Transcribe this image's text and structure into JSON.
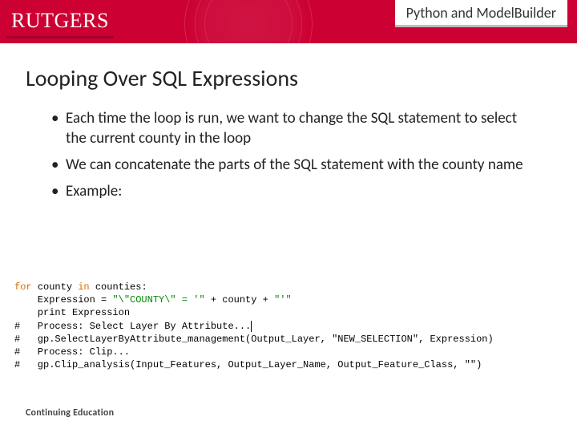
{
  "header": {
    "logo_text": "RUTGERS",
    "right_label": "Python and ModelBuilder"
  },
  "slide": {
    "title": "Looping Over SQL Expressions",
    "bullets": [
      "Each time the loop is run, we want to change the SQL statement to select the current county in the loop",
      "We can concatenate the parts of the SQL statement with the county name",
      "Example:"
    ]
  },
  "code": {
    "kw_for": "for",
    "var_county": "county",
    "kw_in": "in",
    "var_counties": "counties:",
    "assign_line": "    Expression = ",
    "str1": "\"\\\"COUNTY\\\" = '\"",
    "plus1": " + county + ",
    "str2": "\"'\"",
    "print_line": "    print Expression",
    "c1": "#   Process: Select Layer By Attribute...",
    "c2": "#   gp.SelectLayerByAttribute_management(Output_Layer, \"NEW_SELECTION\", Expression)",
    "c3": "#   Process: Clip...",
    "c4": "#   gp.Clip_analysis(Input_Features, Output_Layer_Name, Output_Feature_Class, \"\")"
  },
  "footer": {
    "text": "Continuing Education"
  }
}
